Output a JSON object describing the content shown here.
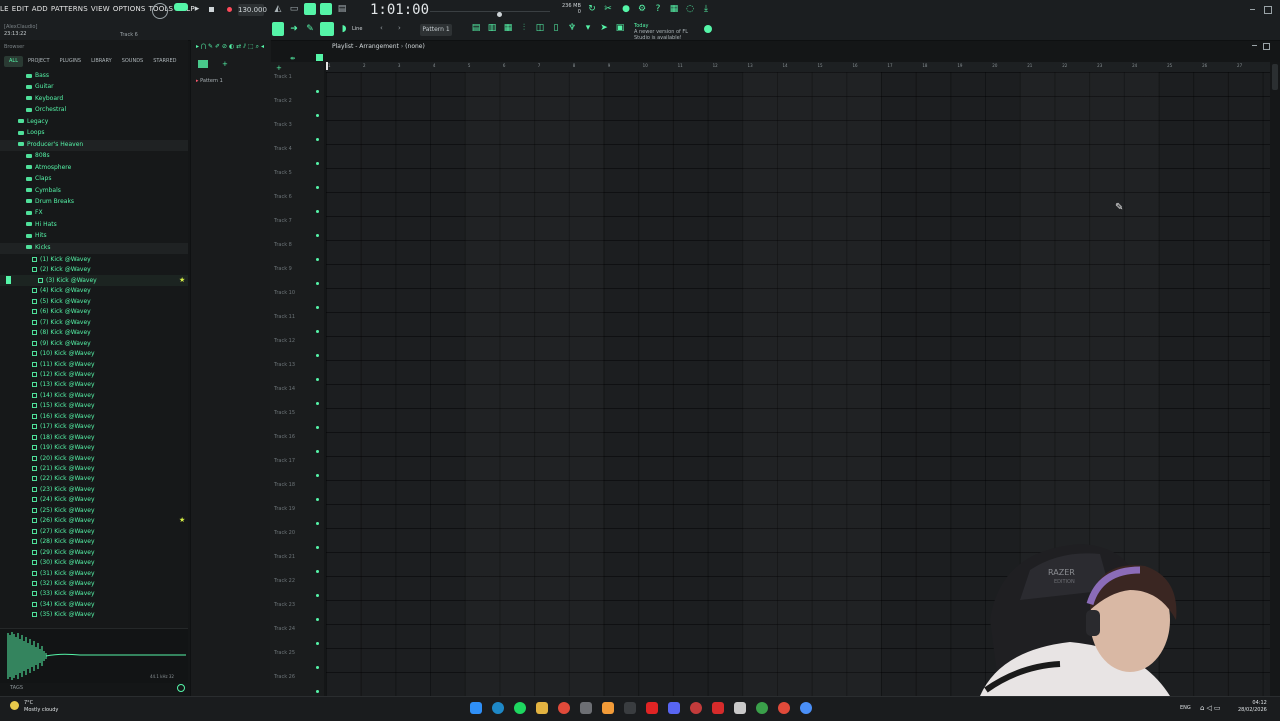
{
  "menu": [
    "LE",
    "EDIT",
    "ADD",
    "PATTERNS",
    "VIEW",
    "OPTIONS",
    "TOOLS",
    "HELP"
  ],
  "header": {
    "user_label": "[AlexClaudio]",
    "time_label": "23:13:22",
    "track_hint": "Track 6",
    "tempo": "130.000",
    "song_position": "1:01:00",
    "cpu_ram": "236 MB",
    "cpu_sub": "0",
    "pattern_name": "Pattern 1",
    "news_day": "Today",
    "news_text": "A newer version of FL Studio is available!",
    "snap_label": "Line"
  },
  "browser": {
    "title": "Browser",
    "tabs": [
      "ALL",
      "PROJECT",
      "PLUGINS",
      "LIBRARY",
      "SOUNDS",
      "STARRED"
    ],
    "folders": [
      "Bass",
      "Guitar",
      "Keyboard",
      "Orchestral",
      "Legacy",
      "Loops",
      "Producer's Heaven",
      "808s",
      "Atmosphere",
      "Claps",
      "Cymbals",
      "Drum Breaks",
      "FX",
      "Hi Hats",
      "Hits",
      "Kicks"
    ],
    "files": [
      "(1) Kick @Wavey",
      "(2) Kick @Wavey",
      "(3) Kick @Wavey",
      "(4) Kick @Wavey",
      "(5) Kick @Wavey",
      "(6) Kick @Wavey",
      "(7) Kick @Wavey",
      "(8) Kick @Wavey",
      "(9) Kick @Wavey",
      "(10) Kick @Wavey",
      "(11) Kick @Wavey",
      "(12) Kick @Wavey",
      "(13) Kick @Wavey",
      "(14) Kick @Wavey",
      "(15) Kick @Wavey",
      "(16) Kick @Wavey",
      "(17) Kick @Wavey",
      "(18) Kick @Wavey",
      "(19) Kick @Wavey",
      "(20) Kick @Wavey",
      "(21) Kick @Wavey",
      "(22) Kick @Wavey",
      "(23) Kick @Wavey",
      "(24) Kick @Wavey",
      "(25) Kick @Wavey",
      "(26) Kick @Wavey",
      "(27) Kick @Wavey",
      "(28) Kick @Wavey",
      "(29) Kick @Wavey",
      "(30) Kick @Wavey",
      "(31) Kick @Wavey",
      "(32) Kick @Wavey",
      "(33) Kick @Wavey",
      "(34) Kick @Wavey",
      "(35) Kick @Wavey"
    ],
    "starred_files": [
      "(3) Kick @Wavey",
      "(26) Kick @Wavey"
    ],
    "tags_label": "TAGS",
    "sample_rate": "44.1 kHz 32"
  },
  "picker": {
    "pattern": "Pattern 1"
  },
  "playlist": {
    "title": "Playlist - Arrangement",
    "subtitle": "(none)",
    "tracks": [
      "Track 1",
      "Track 2",
      "Track 3",
      "Track 4",
      "Track 5",
      "Track 6",
      "Track 7",
      "Track 8",
      "Track 9",
      "Track 10",
      "Track 11",
      "Track 12",
      "Track 13",
      "Track 14",
      "Track 15",
      "Track 16",
      "Track 17",
      "Track 18",
      "Track 19",
      "Track 20",
      "Track 21",
      "Track 22",
      "Track 23",
      "Track 24",
      "Track 25",
      "Track 26"
    ],
    "ruler": [
      "1",
      "2",
      "3",
      "4",
      "5",
      "6",
      "7",
      "8",
      "9",
      "10",
      "11",
      "12",
      "13",
      "14",
      "15",
      "16",
      "17",
      "18",
      "19",
      "20",
      "21",
      "22",
      "23",
      "24",
      "25",
      "26",
      "27"
    ]
  },
  "taskbar": {
    "weather_temp": "7°C",
    "weather_desc": "Mostly cloudy",
    "lang": "ENG",
    "time": "04:12",
    "date": "28/02/2026"
  },
  "webcam": {
    "chair_brand": "RAZER",
    "chair_sub": "EDITION"
  },
  "colors": {
    "accent": "#55f5a8",
    "star": "#d7f046",
    "bg": "#141617"
  }
}
